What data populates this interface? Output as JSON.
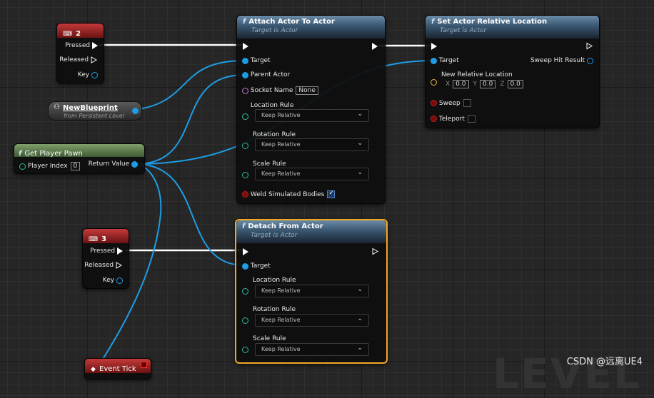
{
  "nodes": {
    "key2": {
      "title": "2",
      "pins": {
        "pressed": "Pressed",
        "released": "Released",
        "key": "Key"
      }
    },
    "key3": {
      "title": "3",
      "pins": {
        "pressed": "Pressed",
        "released": "Released",
        "key": "Key"
      }
    },
    "new_blueprint": {
      "title": "NewBlueprint",
      "subtitle": "from Persistent Level"
    },
    "get_player_pawn": {
      "title": "Get Player Pawn",
      "player_index_label": "Player Index",
      "player_index_value": "0",
      "return_value": "Return Value"
    },
    "attach": {
      "title": "Attach Actor To Actor",
      "subtitle": "Target is Actor",
      "target": "Target",
      "parent_actor": "Parent Actor",
      "socket_name": "Socket Name",
      "socket_value": "None",
      "location_rule": "Location Rule",
      "location_value": "Keep Relative",
      "rotation_rule": "Rotation Rule",
      "rotation_value": "Keep Relative",
      "scale_rule": "Scale Rule",
      "scale_value": "Keep Relative",
      "weld": "Weld Simulated Bodies",
      "weld_checked": true
    },
    "set_location": {
      "title": "Set Actor Relative Location",
      "subtitle": "Target is Actor",
      "target": "Target",
      "sweep_hit": "Sweep Hit Result",
      "new_location": "New Relative Location",
      "x_label": "X",
      "x": "0.0",
      "y_label": "Y",
      "y": "0.0",
      "z_label": "Z",
      "z": "0.0",
      "sweep": "Sweep",
      "teleport": "Teleport"
    },
    "detach": {
      "title": "Detach From Actor",
      "subtitle": "Target is Actor",
      "target": "Target",
      "location_rule": "Location Rule",
      "location_value": "Keep Relative",
      "rotation_rule": "Rotation Rule",
      "rotation_value": "Keep Relative",
      "scale_rule": "Scale Rule",
      "scale_value": "Keep Relative"
    },
    "event_tick": {
      "title": "Event Tick"
    }
  },
  "background_text": "LEVEL",
  "watermark": "CSDN @远离UE4",
  "colors": {
    "object_pin": "#1e9de5",
    "exec_wire": "#ffffff",
    "selected_outline": "#f5a623",
    "function_header": "#3a5670",
    "event_header": "#6a1212"
  }
}
